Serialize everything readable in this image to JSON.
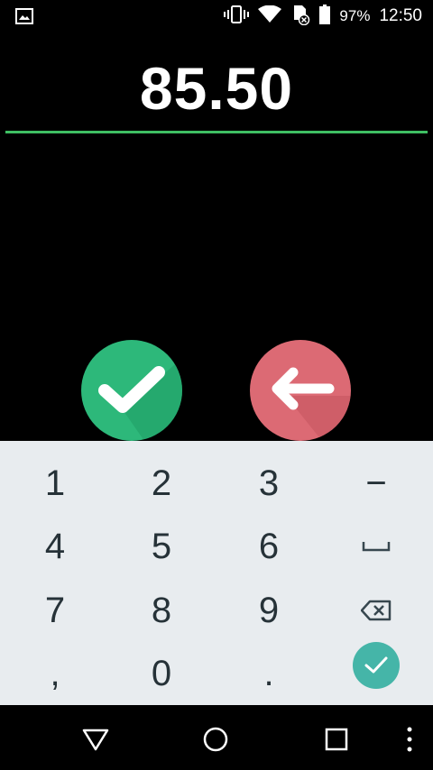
{
  "status_bar": {
    "icons": [
      "image-notification-icon",
      "vibrate-icon",
      "wifi-icon",
      "sd-card-error-icon",
      "battery-icon"
    ],
    "battery": "97%",
    "time": "12:50"
  },
  "display": {
    "amount": "85.50",
    "accent_color": "#3fbf63"
  },
  "actions": {
    "confirm": {
      "icon": "check-icon",
      "color": "#2db87a"
    },
    "back": {
      "icon": "arrow-left-icon",
      "color": "#dc6a74"
    }
  },
  "keypad": {
    "keys": [
      [
        "1",
        "2",
        "3",
        "−"
      ],
      [
        "4",
        "5",
        "6",
        "space-icon"
      ],
      [
        "7",
        "8",
        "9",
        "backspace-icon"
      ],
      [
        ",",
        "0",
        ".",
        "done-icon"
      ]
    ],
    "done_color": "#45b5a8"
  },
  "nav_bar": {
    "icons": [
      "back-triangle-icon",
      "home-circle-icon",
      "recents-square-icon",
      "more-vert-icon"
    ]
  }
}
